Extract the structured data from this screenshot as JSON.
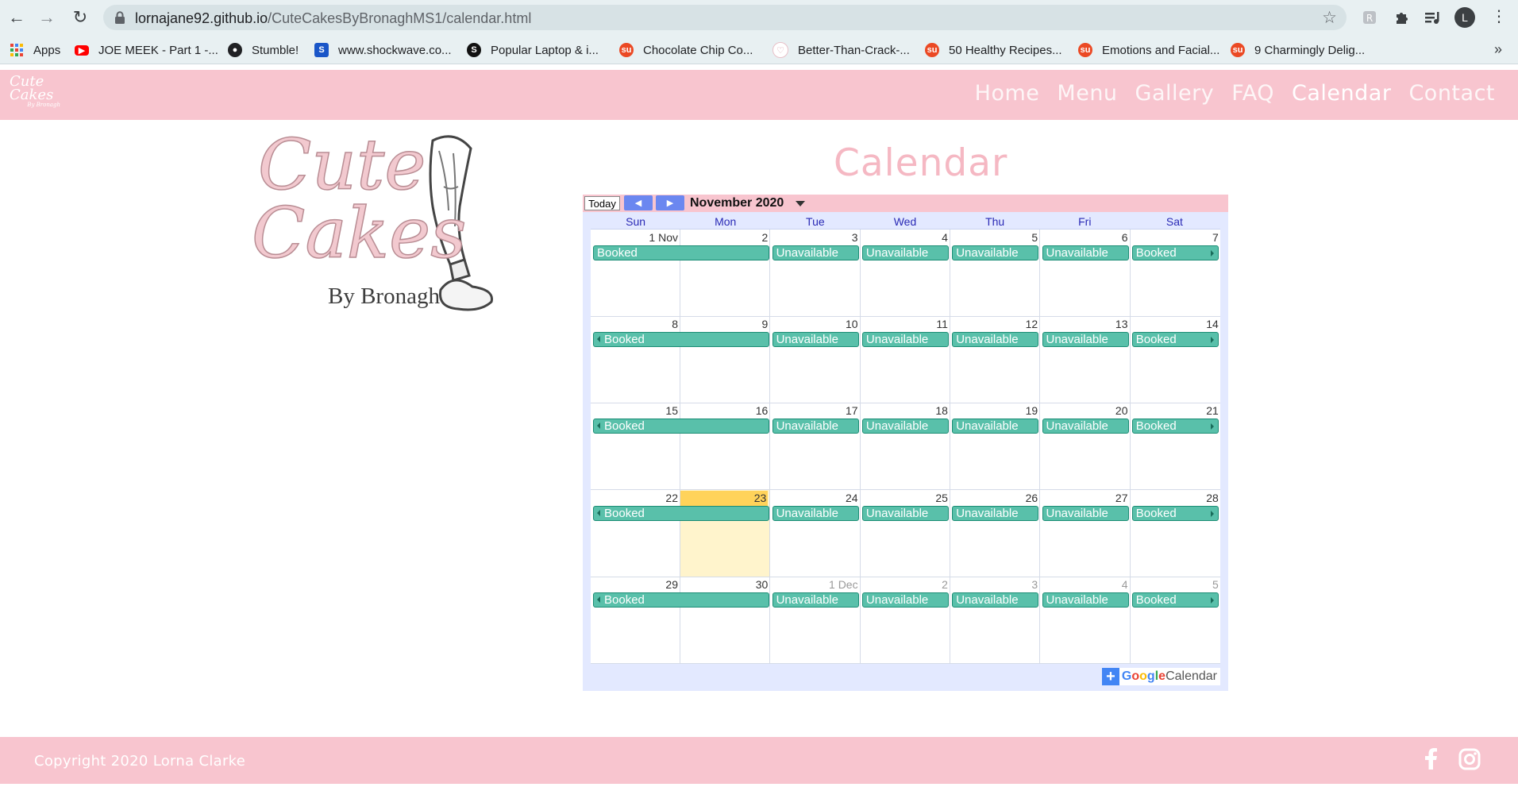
{
  "browser": {
    "url_host": "lornajane92.github.io",
    "url_path": "/CuteCakesByBronaghMS1/calendar.html",
    "profile_initial": "L",
    "bookmarks": [
      {
        "label": "Apps",
        "icon": "apps-grid-icon",
        "color": "#ea4335"
      },
      {
        "label": "JOE MEEK - Part 1 -...",
        "icon": "youtube-icon",
        "color": "#ff0000"
      },
      {
        "label": "Stumble!",
        "icon": "globe-icon",
        "color": "#202124"
      },
      {
        "label": "www.shockwave.co...",
        "icon": "shockwave-icon",
        "color": "#1a56c8"
      },
      {
        "label": "Popular Laptop & i...",
        "icon": "site-icon",
        "color": "#111111"
      },
      {
        "label": "Chocolate Chip Co...",
        "icon": "stumbleupon-icon",
        "color": "#eb4924"
      },
      {
        "label": "Better-Than-Crack-...",
        "icon": "heart-icon",
        "color": "#e8c0c8"
      },
      {
        "label": "50 Healthy Recipes...",
        "icon": "stumbleupon-icon",
        "color": "#eb4924"
      },
      {
        "label": "Emotions and Facial...",
        "icon": "stumbleupon-icon",
        "color": "#eb4924"
      },
      {
        "label": "9 Charmingly Delig...",
        "icon": "stumbleupon-icon",
        "color": "#eb4924"
      }
    ],
    "bookmarks_more": "»"
  },
  "site": {
    "mini_logo_line1": "Cute",
    "mini_logo_line2": "Cakes",
    "mini_logo_by": "By Bronagh",
    "nav": [
      "Home",
      "Menu",
      "Gallery",
      "FAQ",
      "Calendar",
      "Contact"
    ],
    "active_nav": "Calendar",
    "logo_line1": "Cute",
    "logo_line2": "Cakes",
    "logo_by": "By Bronagh",
    "page_title": "Calendar",
    "footer_copyright": "Copyright 2020 Lorna Clarke",
    "brand_pink": "#f8c5cf"
  },
  "calendar": {
    "today_label": "Today",
    "prev_icon": "chevron-left-icon",
    "next_icon": "chevron-right-icon",
    "month_label": "November 2020",
    "weekdays": [
      "Sun",
      "Mon",
      "Tue",
      "Wed",
      "Thu",
      "Fri",
      "Sat"
    ],
    "weeks": [
      {
        "days": [
          "1 Nov",
          "2",
          "3",
          "4",
          "5",
          "6",
          "7"
        ],
        "other": [
          false,
          false,
          false,
          false,
          false,
          false,
          false
        ],
        "booked_left": "Booked",
        "booked_right": "Booked",
        "unavailable": [
          "Unavailable",
          "Unavailable",
          "Unavailable",
          "Unavailable"
        ],
        "cont_left": false
      },
      {
        "days": [
          "8",
          "9",
          "10",
          "11",
          "12",
          "13",
          "14"
        ],
        "other": [
          false,
          false,
          false,
          false,
          false,
          false,
          false
        ],
        "booked_left": "Booked",
        "booked_right": "Booked",
        "unavailable": [
          "Unavailable",
          "Unavailable",
          "Unavailable",
          "Unavailable"
        ],
        "cont_left": true
      },
      {
        "days": [
          "15",
          "16",
          "17",
          "18",
          "19",
          "20",
          "21"
        ],
        "other": [
          false,
          false,
          false,
          false,
          false,
          false,
          false
        ],
        "booked_left": "Booked",
        "booked_right": "Booked",
        "unavailable": [
          "Unavailable",
          "Unavailable",
          "Unavailable",
          "Unavailable"
        ],
        "cont_left": true
      },
      {
        "days": [
          "22",
          "23",
          "24",
          "25",
          "26",
          "27",
          "28"
        ],
        "other": [
          false,
          false,
          false,
          false,
          false,
          false,
          false
        ],
        "booked_left": "Booked",
        "booked_right": "Booked",
        "unavailable": [
          "Unavailable",
          "Unavailable",
          "Unavailable",
          "Unavailable"
        ],
        "cont_left": true
      },
      {
        "days": [
          "29",
          "30",
          "1 Dec",
          "2",
          "3",
          "4",
          "5"
        ],
        "other": [
          false,
          false,
          true,
          true,
          true,
          true,
          true
        ],
        "booked_left": "Booked",
        "booked_right": "Booked",
        "unavailable": [
          "Unavailable",
          "Unavailable",
          "Unavailable",
          "Unavailable"
        ],
        "cont_left": true
      }
    ],
    "today_day": "23",
    "event_color": "#59c0aa",
    "today_color": "#ffd35a",
    "gcal_word_google": "Google",
    "gcal_word_calendar": "Calendar"
  }
}
